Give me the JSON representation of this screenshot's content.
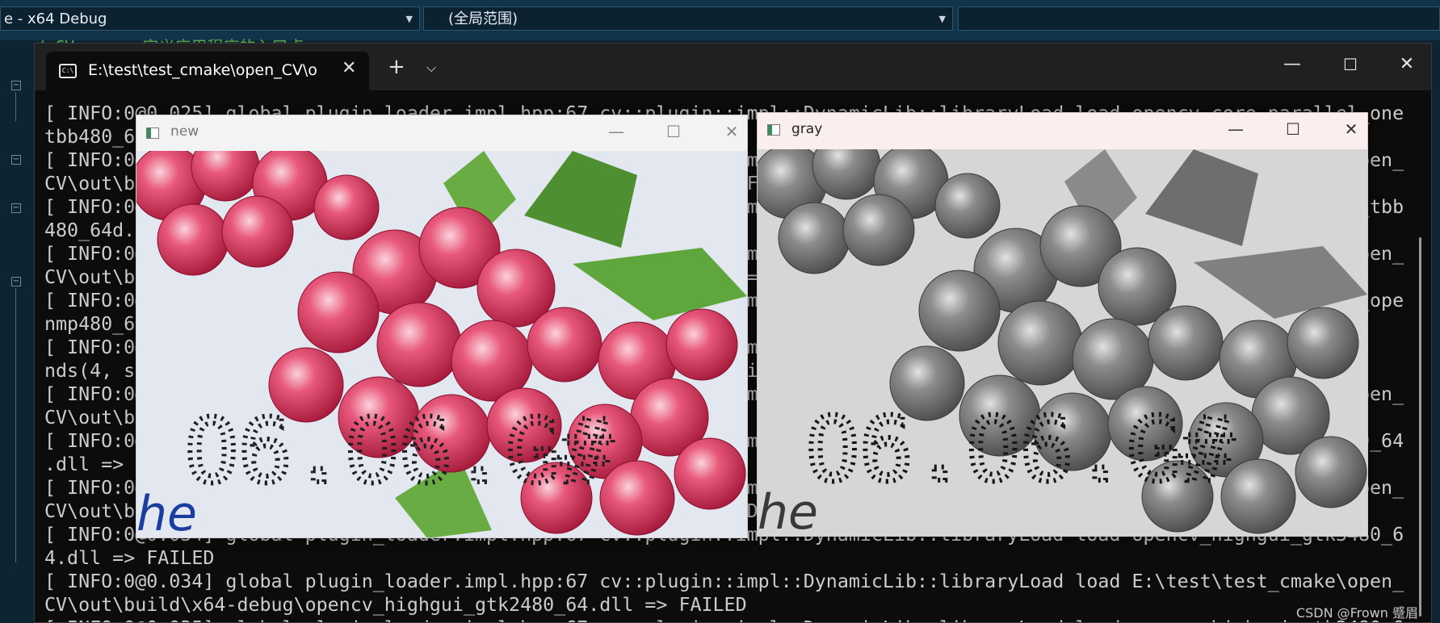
{
  "ide": {
    "config_combo": "e - x64 Debug",
    "scope_combo": "(全局范围)",
    "comment_fragment": "//       CV.cpp : 定义应用程序的入口点。"
  },
  "terminal": {
    "tab_title": "E:\\test\\test_cmake\\open_CV\\o",
    "new_tab_glyph": "+",
    "lines": [
      "[ INFO:0@0.025] global plugin_loader.impl.hpp:67 cv::plugin::impl::DynamicLib::libraryLoad load opencv_core_parallel_one",
      "tbb480_64d.dll => FAILED",
      "[ INFO:0@0.025] global plugin_loader.impl.hpp:67 cv::plugin::impl::DynamicLib::libraryLoad load E:\\test\\test_cmake\\open_",
      "CV\\out\\build\\x64-debug\\opencv_core_parallel_tbb480_64d.dll => FAILED",
      "[ INFO:0@0.025] global plugin_loader.impl.hpp:67 cv::plugin::impl::DynamicLib::libraryLoad load opencv_core_parallel_tbb",
      "480_64d.dll => FAILED",
      "[ INFO:0@0.026] global plugin_loader.impl.hpp:67 cv::plugin::impl::DynamicLib::libraryLoad load E:\\test\\test_cmake\\open_",
      "CV\\out\\build\\x64-debug\\opencv_core_parallel_openmp480_64d.dll => FAILED",
      "[ INFO:0@0.026] global plugin_loader.impl.hpp:67 cv::plugin::impl::DynamicLib::libraryLoad load opencv_core_parallel_ope",
      "nmp480_64d.dll => FAILED",
      "[ INFO:0@0.027] global plugin_loader.impl.hpp:67 cv::plugin::impl::DynamicLib::libraryLoad load opencv_highgui_backe",
      "nds(4, sorted by priority): GTK(1000); GTK3(990); GTK2(980); Win32 UI(970) + BUILTIN(WIN32UI)",
      "[ INFO:0@0.031] global plugin_loader.impl.hpp:67 cv::plugin::impl::DynamicLib::libraryLoad load E:\\test\\test_cmake\\open_",
      "CV\\out\\build\\x64-debug\\opencv_highgui_gtk480_64d.dll => FAILED",
      "[ INFO:0@0.032] global plugin_loader.impl.hpp:67 cv::plugin::impl::DynamicLib::libraryLoad load opencv_highgui_gtk480_64",
      ".dll => FAILED",
      "[ INFO:0@0.033] global plugin_loader.impl.hpp:67 cv::plugin::impl::DynamicLib::libraryLoad load E:\\test\\test_cmake\\open_",
      "CV\\out\\build\\x64-debug\\opencv_highgui_gtk3480_64d.dll => FAILED",
      "[ INFO:0@0.034] global plugin_loader.impl.hpp:67 cv::plugin::impl::DynamicLib::libraryLoad load opencv_highgui_gtk3480_6",
      "4.dll => FAILED",
      "[ INFO:0@0.034] global plugin_loader.impl.hpp:67 cv::plugin::impl::DynamicLib::libraryLoad load E:\\test\\test_cmake\\open_",
      "CV\\out\\build\\x64-debug\\opencv_highgui_gtk2480_64.dll => FAILED",
      "[ INFO:0@0.035] global plugin_loader.impl.hpp:67 cv::plugin::impl::DynamicLib::libraryLoad load opencv_highgui_gtk2480_6"
    ],
    "watermark": "CSDN @Frown 蹙眉"
  },
  "windows": {
    "new": {
      "title": "new"
    },
    "gray": {
      "title": "gray"
    },
    "image_text": "O6.O6.G#"
  },
  "colors": {
    "ide_bg": "#0d2433",
    "terminal_bg": "#0c0c0c",
    "terminal_text": "#cccccc",
    "raspberry": "#d63a5c",
    "leaf": "#5d9e3a"
  }
}
